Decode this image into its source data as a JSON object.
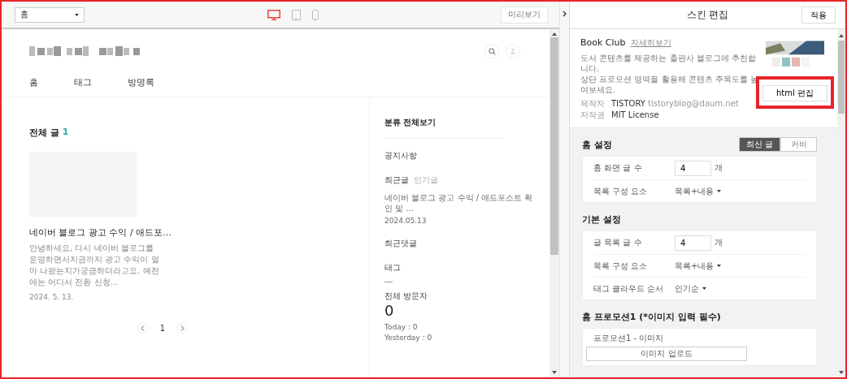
{
  "toolbar": {
    "page_select": "홈",
    "devices": [
      {
        "kind": "desktop",
        "selected": true
      },
      {
        "kind": "tablet",
        "selected": false
      },
      {
        "kind": "mobile",
        "selected": false
      }
    ],
    "preview_button": "미리보기"
  },
  "blog": {
    "nav": [
      "홈",
      "태그",
      "방명록"
    ],
    "heading": "전체 글",
    "count": "1",
    "post": {
      "title": "네이버 블로그 광고 수익 / 애드포...",
      "excerpt": "안녕하세요, 다시 네이버 블로그를 운영하면서지금까지 광고 수익이 얼마 나왔는지가궁금하더라고요. 예전에는 어디서 전환 신청...",
      "date": "2024. 5. 13."
    },
    "pagination": {
      "page": "1"
    },
    "sidebar": {
      "category": "분류 전체보기",
      "notice": "공지사항",
      "tabs": [
        {
          "label": "최근글",
          "selected": true
        },
        {
          "label": "인기글",
          "selected": false
        }
      ],
      "recent_title": "네이버 블로그 광고 수익 / 애드포스트 확인 및 ...",
      "recent_date": "2024.05.13",
      "comments": "최근댓글",
      "tags": "태그",
      "visitors_label": "전체 방문자",
      "visitors_total": "0",
      "today": "Today : 0",
      "yesterday": "Yesterday : 0"
    }
  },
  "editor": {
    "title": "스킨 편집",
    "apply_button": "적용",
    "skin": {
      "name": "Book Club",
      "details_link": "자세히보기",
      "description": [
        "도서 콘텐츠를 제공하는 출판사 블로그에 추천합니다.",
        "상단 프로모션 영역을 활용해 콘텐츠 주목도를 높여보세요."
      ],
      "meta": [
        {
          "label": "제작자",
          "value": "TISTORY",
          "extra": "tistoryblog@daum.net"
        },
        {
          "label": "저작권",
          "value": "MIT License"
        }
      ],
      "html_button": "html 편집"
    },
    "sections": [
      {
        "title": "홈 설정",
        "toggle": [
          {
            "label": "최신 글",
            "selected": true
          },
          {
            "label": "커버",
            "selected": false
          }
        ],
        "rows": [
          {
            "kind": "number",
            "label": "홈 화면 글 수",
            "value": "4",
            "unit": "개"
          },
          {
            "kind": "select",
            "label": "목록 구성 요소",
            "value": "목록+내용"
          }
        ]
      },
      {
        "title": "기본 설정",
        "rows": [
          {
            "kind": "number",
            "label": "글 목록 글 수",
            "value": "4",
            "unit": "개"
          },
          {
            "kind": "select",
            "label": "목록 구성 요소",
            "value": "목록+내용"
          },
          {
            "kind": "select",
            "label": "태그 클라우드 순서",
            "value": "인기순"
          }
        ]
      },
      {
        "title": "홈 프로모션1 (*이미지 입력 필수)",
        "rows": [
          {
            "kind": "upload",
            "label": "프로모션1 - 이미지",
            "button": "이미지 업로드"
          }
        ]
      }
    ]
  }
}
